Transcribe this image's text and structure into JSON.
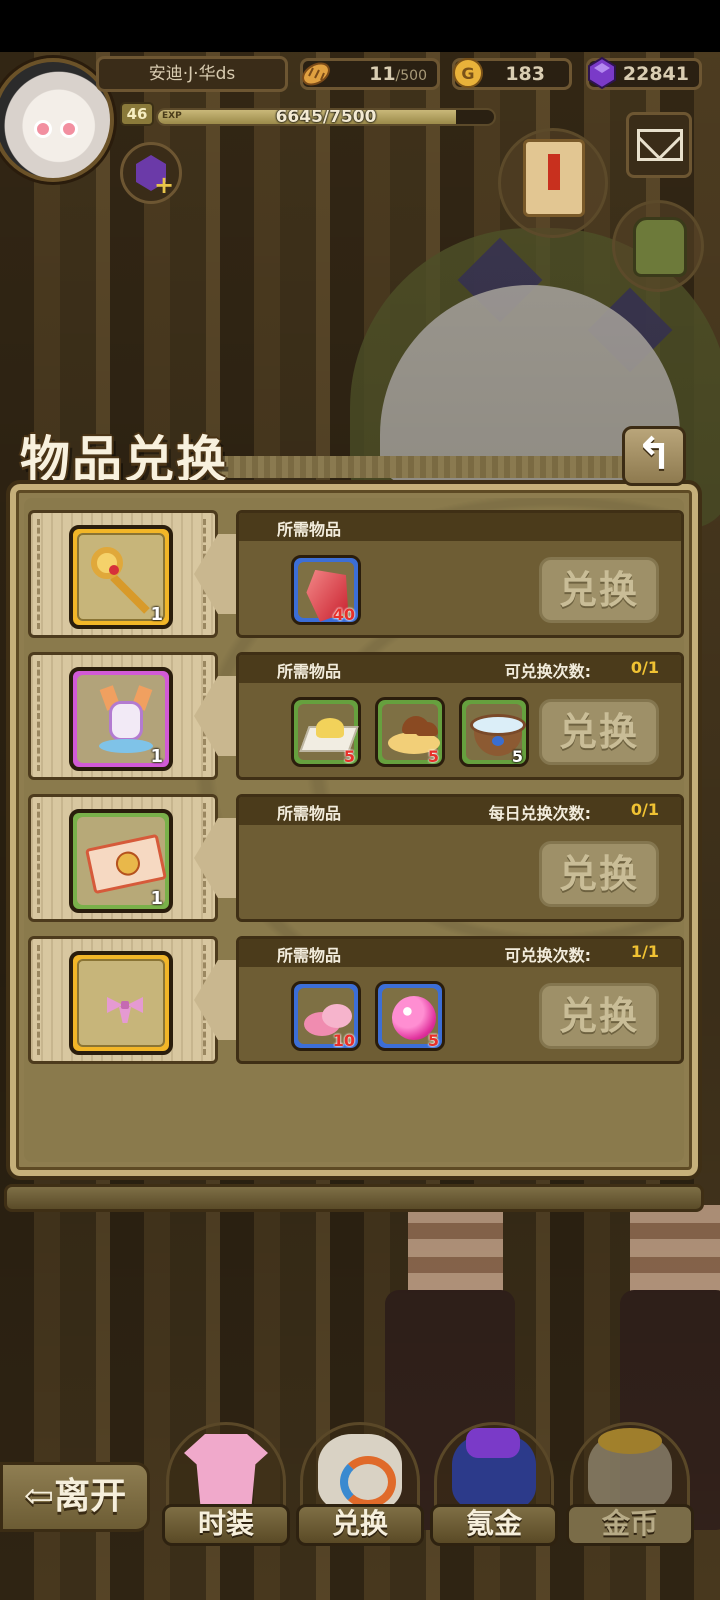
{
  "player": {
    "name": "安迪·J·华ds",
    "level": "46",
    "exp_label": "EXP",
    "exp_text": "6645/7500",
    "exp_fraction": 0.886
  },
  "resources": {
    "stamina": {
      "value": "11",
      "max": "/500"
    },
    "gold": {
      "value": "183"
    },
    "gems": {
      "value": "22841"
    }
  },
  "panel": {
    "title": "物品兑换",
    "back_glyph": "↰",
    "required_label": "所需物品",
    "exchange_label": "兑换",
    "rows": [
      {
        "slot": "gold",
        "reward_icon": "golden-key",
        "reward_qty": "1",
        "limit_label": "",
        "limit_value": "",
        "costs": [
          {
            "icon": "ruby",
            "qty": "40",
            "frame": "blue",
            "qty_color": "red"
          }
        ]
      },
      {
        "slot": "purple",
        "reward_icon": "figurine",
        "reward_qty": "1",
        "limit_label": "可兑换次数:",
        "limit_value": "0/1",
        "costs": [
          {
            "icon": "powder",
            "qty": "5",
            "frame": "green",
            "qty_color": "red"
          },
          {
            "icon": "mushroom-dough",
            "qty": "5",
            "frame": "green",
            "qty_color": "red"
          },
          {
            "icon": "pet-bowl",
            "qty": "5",
            "frame": "green",
            "qty_color": "white"
          }
        ]
      },
      {
        "slot": "green",
        "reward_icon": "ticket",
        "reward_qty": "1",
        "limit_label": "每日兑换次数:",
        "limit_value": "0/1",
        "costs": []
      },
      {
        "slot": "gold",
        "reward_icon": "pink-bow",
        "reward_qty": "",
        "limit_label": "可兑换次数:",
        "limit_value": "1/1",
        "costs": [
          {
            "icon": "pink-cake",
            "qty": "10",
            "frame": "blue",
            "qty_color": "red"
          },
          {
            "icon": "pink-orb",
            "qty": "5",
            "frame": "blue",
            "qty_color": "red"
          }
        ]
      }
    ]
  },
  "nav": {
    "leave": "⇦离开",
    "items": [
      {
        "label": "时装",
        "icon": "shirt-icon",
        "active": true
      },
      {
        "label": "兑换",
        "icon": "exchange-bag-icon",
        "active": true
      },
      {
        "label": "氪金",
        "icon": "gem-bag-icon",
        "active": true
      },
      {
        "label": "金币",
        "icon": "coin-bag-icon",
        "active": false
      }
    ]
  },
  "colors": {
    "limit_value": "#f0c233",
    "qty_red": "#e8302a",
    "slot_gold": "#f2b628",
    "slot_purple": "#d25ad6",
    "slot_green": "#7ab04a",
    "cost_blue": "#3c6ed6",
    "cost_green": "#66a03e"
  }
}
